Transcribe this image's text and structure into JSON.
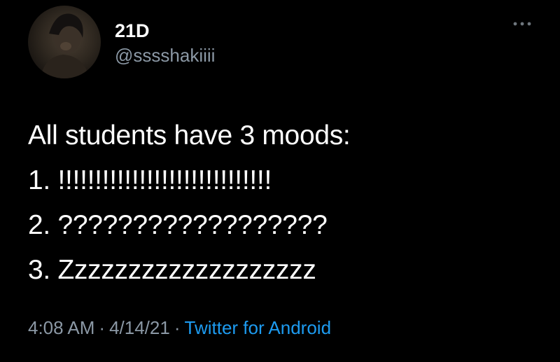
{
  "tweet": {
    "display_name": "21D",
    "handle": "@sssshakiiii",
    "lines": [
      "All students have 3 moods:",
      "1. !!!!!!!!!!!!!!!!!!!!!!!!!!!!!",
      "2. ??????????????????",
      "3. Zzzzzzzzzzzzzzzzzzz"
    ],
    "time": "4:08 AM",
    "date": "4/14/21",
    "source": "Twitter for Android",
    "separator": "·"
  },
  "icons": {
    "more": "more-options-icon"
  },
  "colors": {
    "background": "#000000",
    "text_primary": "#ffffff",
    "text_secondary": "#8b98a5",
    "link": "#1d9bf0"
  }
}
